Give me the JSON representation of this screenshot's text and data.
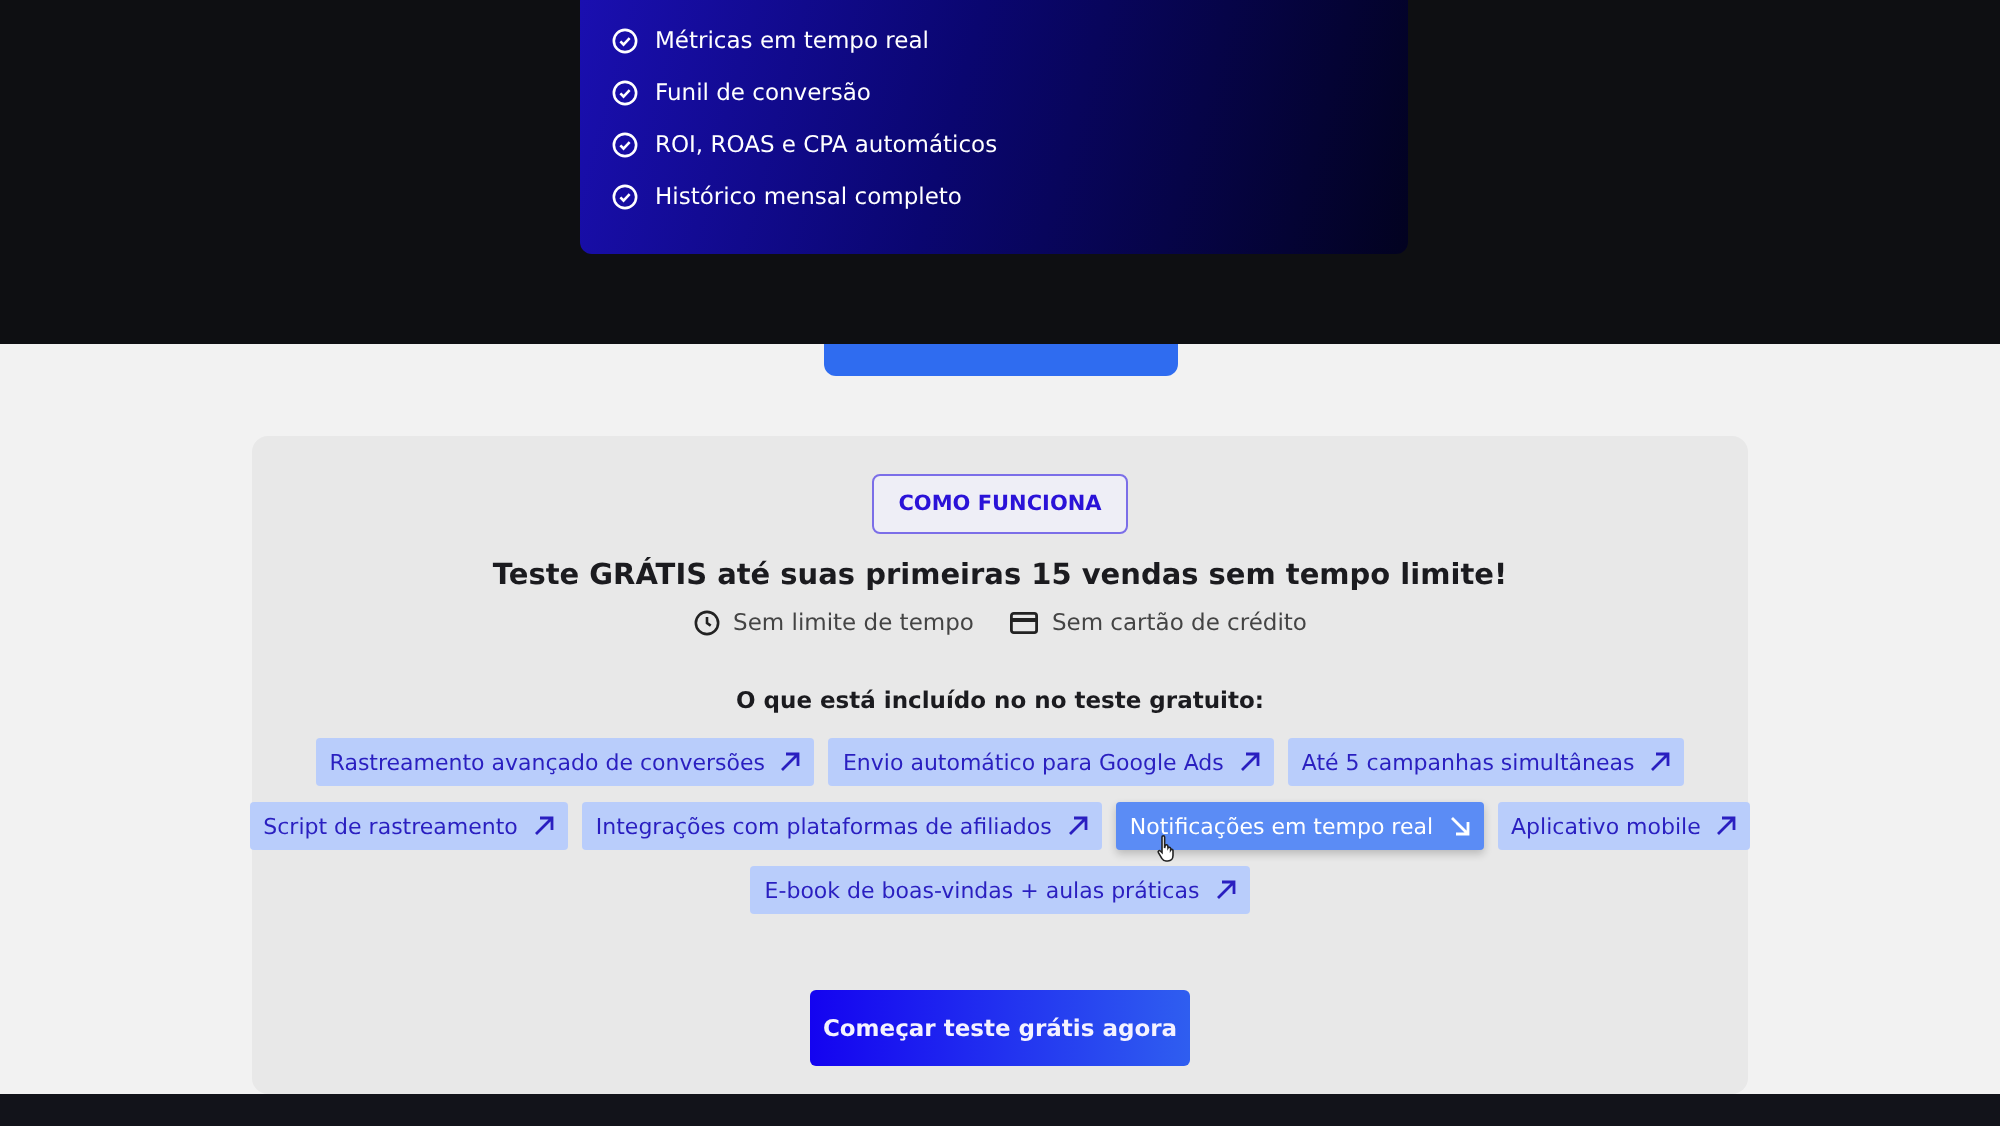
{
  "plan_card": {
    "features": [
      {
        "label": "Métricas em tempo real"
      },
      {
        "label": "Funil de conversão"
      },
      {
        "label": "ROI, ROAS e CPA automáticos"
      },
      {
        "label": "Histórico mensal completo"
      }
    ]
  },
  "trial": {
    "badge": "COMO FUNCIONA",
    "headline": "Teste GRÁTIS até suas primeiras 15 vendas sem tempo limite!",
    "perks": [
      {
        "kind": "clock",
        "label": "Sem limite de tempo"
      },
      {
        "kind": "card",
        "label": "Sem cartão de crédito"
      }
    ],
    "included_title": "O que está incluído no no teste gratuito:",
    "chip_rows": [
      [
        {
          "label": "Rastreamento avançado de conversões",
          "highlighted": false
        },
        {
          "label": "Envio automático para Google Ads",
          "highlighted": false
        },
        {
          "label": "Até 5 campanhas simultâneas",
          "highlighted": false
        }
      ],
      [
        {
          "label": "Script de rastreamento",
          "highlighted": false
        },
        {
          "label": "Integrações com plataformas de afiliados",
          "highlighted": false
        },
        {
          "label": "Notificações em tempo real",
          "highlighted": true
        },
        {
          "label": "Aplicativo mobile",
          "highlighted": false
        }
      ],
      [
        {
          "label": "E-book de boas-vindas + aulas práticas",
          "highlighted": false
        }
      ]
    ],
    "cta": "Começar teste grátis agora"
  }
}
